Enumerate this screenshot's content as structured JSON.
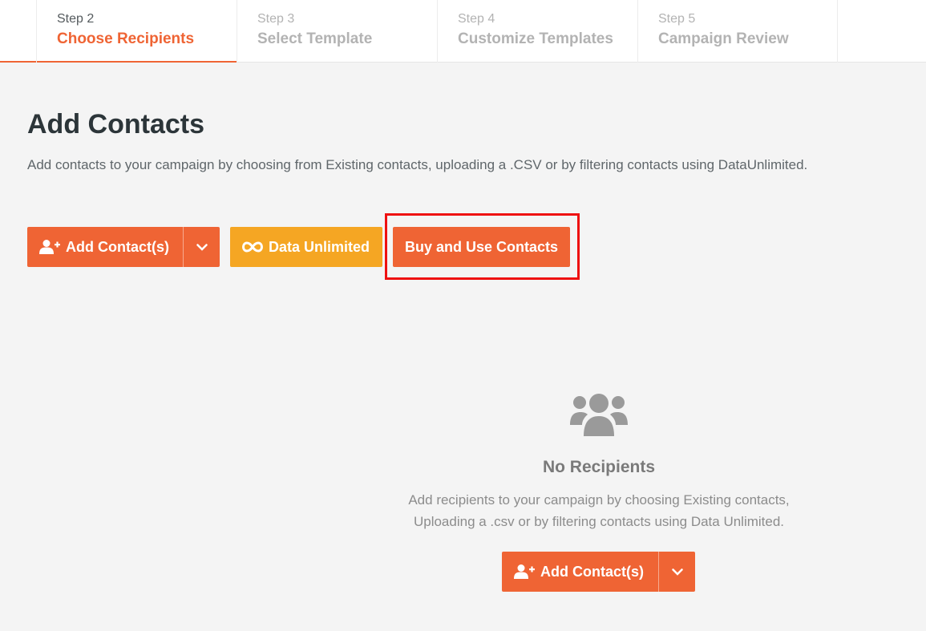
{
  "steps": [
    {
      "num": "Step 2",
      "title": "Choose Recipients"
    },
    {
      "num": "Step 3",
      "title": "Select Template"
    },
    {
      "num": "Step 4",
      "title": "Customize Templates"
    },
    {
      "num": "Step 5",
      "title": "Campaign Review"
    }
  ],
  "active_step": "Step 2",
  "main": {
    "title": "Add Contacts",
    "description": "Add contacts to your campaign by choosing from Existing contacts, uploading a .CSV or by filtering contacts using DataUnlimited."
  },
  "toolbar": {
    "add_contacts_label": "Add Contact(s)",
    "data_unlimited_label": "Data Unlimited",
    "buy_contacts_label": "Buy and Use Contacts"
  },
  "empty_state": {
    "icon": "users-icon",
    "title": "No Recipients",
    "desc_line1": "Add recipients to your campaign by choosing Existing contacts,",
    "desc_line2": "Uploading a .csv or by filtering contacts using Data Unlimited.",
    "add_contacts_label": "Add Contact(s)"
  },
  "colors": {
    "accent": "#ef6434",
    "yellow": "#f5a623",
    "highlight": "#ee1111"
  }
}
